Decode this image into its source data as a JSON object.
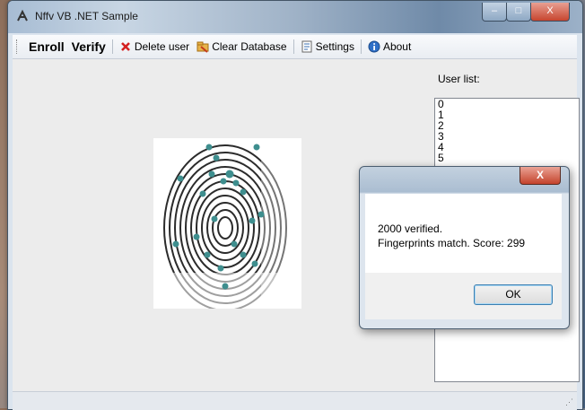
{
  "window": {
    "title": "Nffv VB .NET Sample",
    "caption_min": "–",
    "caption_max": "□",
    "caption_close": "X"
  },
  "toolbar": {
    "enroll": "Enroll",
    "verify": "Verify",
    "delete_user": "Delete user",
    "clear_database": "Clear Database",
    "settings": "Settings",
    "about": "About"
  },
  "user_list": {
    "label": "User list:",
    "items": [
      "0",
      "1",
      "2",
      "3",
      "4",
      "5"
    ]
  },
  "dialog": {
    "close": "X",
    "line1": "2000 verified.",
    "line2": "Fingerprints match. Score: 299",
    "ok_label": "OK"
  },
  "status_bar": {
    "grip": "⋰"
  },
  "colors": {
    "minutiae": "#3e8e8e",
    "delete_icon": "#d42020",
    "close_button": "#c7452f"
  }
}
